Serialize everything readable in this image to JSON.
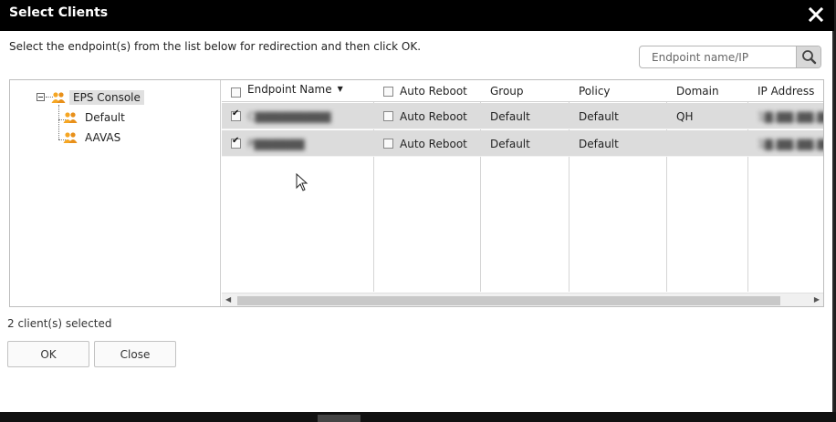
{
  "dialog": {
    "title": "Select Clients",
    "instruction": "Select the endpoint(s) from the list below for redirection and then click OK.",
    "search": {
      "placeholder": "Endpoint name/IP",
      "value": ""
    }
  },
  "tree": {
    "root": {
      "label": "EPS Console",
      "expanded": true,
      "selected": true
    },
    "children": [
      {
        "label": "Default"
      },
      {
        "label": "AAVAS"
      }
    ]
  },
  "grid": {
    "columns": [
      {
        "label": "Endpoint Name",
        "has_checkbox": true,
        "sorted": "desc"
      },
      {
        "label": "Auto Reboot",
        "has_checkbox": true
      },
      {
        "label": "Group"
      },
      {
        "label": "Policy"
      },
      {
        "label": "Domain"
      },
      {
        "label": "IP Address"
      }
    ],
    "rows": [
      {
        "selected": true,
        "endpoint_name": "C▇▇▇▇▇▇▇▇▇",
        "auto_reboot": false,
        "auto_reboot_label": "Auto Reboot",
        "group": "Default",
        "policy": "Default",
        "domain": "QH",
        "ip_address": "1▇.▇▇.▇▇.▇▇"
      },
      {
        "selected": true,
        "endpoint_name": "P▇▇▇▇▇▇",
        "auto_reboot": false,
        "auto_reboot_label": "Auto Reboot",
        "group": "Default",
        "policy": "Default",
        "domain": "",
        "ip_address": "1▇.▇▇.▇▇.▇▇"
      }
    ]
  },
  "footer": {
    "selected_count": "2 client(s) selected",
    "ok_label": "OK",
    "close_label": "Close"
  },
  "colors": {
    "titlebar": "#000000",
    "row_selected": "#dcdcdc",
    "user_icon": "#f5a623"
  },
  "icons": {
    "close": "close-icon",
    "search": "search-icon",
    "group": "user-group-icon"
  }
}
